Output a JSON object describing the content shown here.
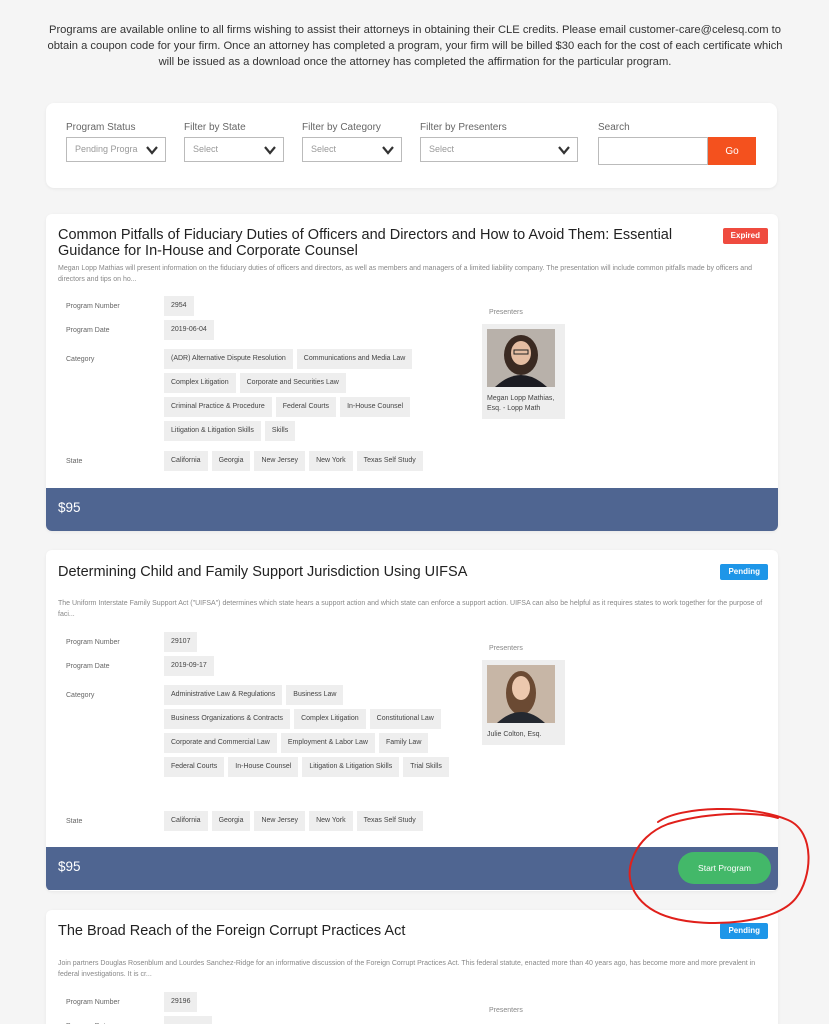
{
  "intro_text": "Programs are available online to all firms wishing to assist their attorneys in obtaining their CLE credits. Please email customer-care@celesq.com to obtain a coupon code for your firm. Once an attorney has completed a program, your firm will be billed $30 each for the cost of each certificate which will be issued as a download once the attorney has completed the affirmation for the particular program.",
  "filters": {
    "status": {
      "label": "Program Status",
      "value": "Pending Progra"
    },
    "state": {
      "label": "Filter by State",
      "value": "Select"
    },
    "category": {
      "label": "Filter by Category",
      "value": "Select"
    },
    "presenters": {
      "label": "Filter by Presenters",
      "value": "Select"
    },
    "search": {
      "label": "Search",
      "value": "",
      "button": "Go"
    }
  },
  "labels": {
    "program_number": "Program Number",
    "program_date": "Program Date",
    "category": "Category",
    "state": "State",
    "presenters": "Presenters"
  },
  "programs": [
    {
      "title": "Common Pitfalls of Fiduciary Duties of Officers and Directors and How to Avoid Them: Essential Guidance for In-House and Corporate Counsel",
      "status": "Expired",
      "description": "Megan Lopp Mathias will present information on the fiduciary duties of officers and directors, as well as members and managers of a limited liability company. The presentation will include common pitfalls made by officers and directors and tips on ho...",
      "number": "2954",
      "date": "2019-06-04",
      "categories": [
        "(ADR) Alternative Dispute Resolution",
        "Communications and Media Law",
        "Complex Litigation",
        "Corporate and Securities Law",
        "Criminal Practice & Procedure",
        "Federal Courts",
        "In-House Counsel",
        "Litigation & Litigation Skills",
        "Skills"
      ],
      "states": [
        "California",
        "Georgia",
        "New Jersey",
        "New York",
        "Texas Self Study"
      ],
      "presenter": "Megan Lopp Mathias, Esq. - Lopp Math",
      "price": "$95"
    },
    {
      "title": "Determining Child and Family Support Jurisdiction Using UIFSA",
      "status": "Pending",
      "description": "The Uniform Interstate Family Support Act (\"UIFSA\") determines which state hears a support action and which state can enforce a support action. UIFSA can also be helpful as it requires states to work together for the purpose of faci...",
      "number": "29107",
      "date": "2019-09-17",
      "categories": [
        "Administrative Law & Regulations",
        "Business Law",
        "Business Organizations & Contracts",
        "Complex Litigation",
        "Constitutional Law",
        "Corporate and Commercial Law",
        "Employment & Labor Law",
        "Family Law",
        "Federal Courts",
        "In-House Counsel",
        "Litigation & Litigation Skills",
        "Trial Skills"
      ],
      "states": [
        "California",
        "Georgia",
        "New Jersey",
        "New York",
        "Texas Self Study"
      ],
      "presenter": "Julie Colton, Esq.",
      "price": "$95",
      "button": "Start Program"
    },
    {
      "title": "The Broad Reach of the Foreign Corrupt Practices Act",
      "status": "Pending",
      "description": "Join partners Douglas Rosenblum and Lourdes Sanchez-Ridge for an informative discussion of the Foreign Corrupt Practices Act. This federal statute, enacted more than 40 years ago, has become more and more prevalent in federal investigations. It is cr...",
      "number": "29196"
    }
  ],
  "colors": {
    "go_button": "#f4511e",
    "expired_badge": "#ef4b3f",
    "pending_badge": "#1e96e8",
    "price_bar": "#4f6591",
    "start_button": "#43b869",
    "annotation": "#e0201b"
  }
}
